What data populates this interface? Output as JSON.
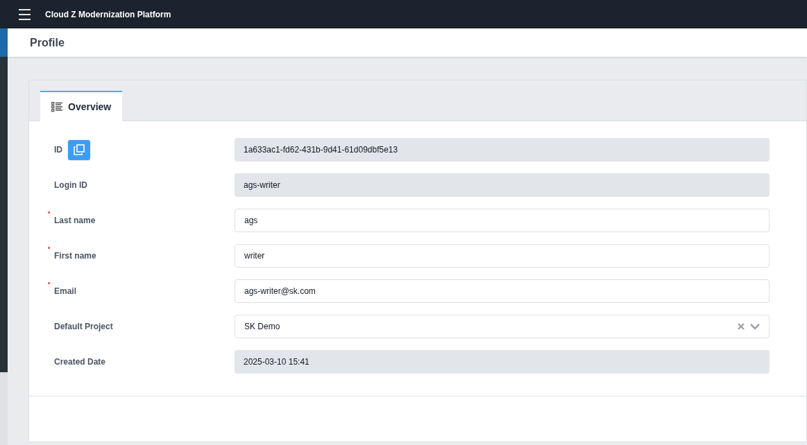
{
  "app": {
    "title": "Cloud Z Modernization Platform"
  },
  "page": {
    "title": "Profile"
  },
  "tabs": [
    {
      "label": "Overview",
      "selected": true
    }
  ],
  "fields": [
    {
      "label": "ID",
      "kind": "readonly",
      "value": "1a633ac1-fd62-431b-9d41-61d09dbf5e13",
      "copy_button": true
    },
    {
      "label": "Login ID",
      "kind": "readonly",
      "value": "ags-writer"
    },
    {
      "label": "Last name",
      "kind": "text",
      "value": "ags",
      "required": true
    },
    {
      "label": "First name",
      "kind": "text",
      "value": "writer",
      "required": true
    },
    {
      "label": "Email",
      "kind": "text",
      "value": "ags-writer@sk.com",
      "required": true
    },
    {
      "label": "Default Project",
      "kind": "select",
      "value": "SK Demo"
    },
    {
      "label": "Created Date",
      "kind": "readonly",
      "value": "2025-03-10 15:41"
    }
  ]
}
